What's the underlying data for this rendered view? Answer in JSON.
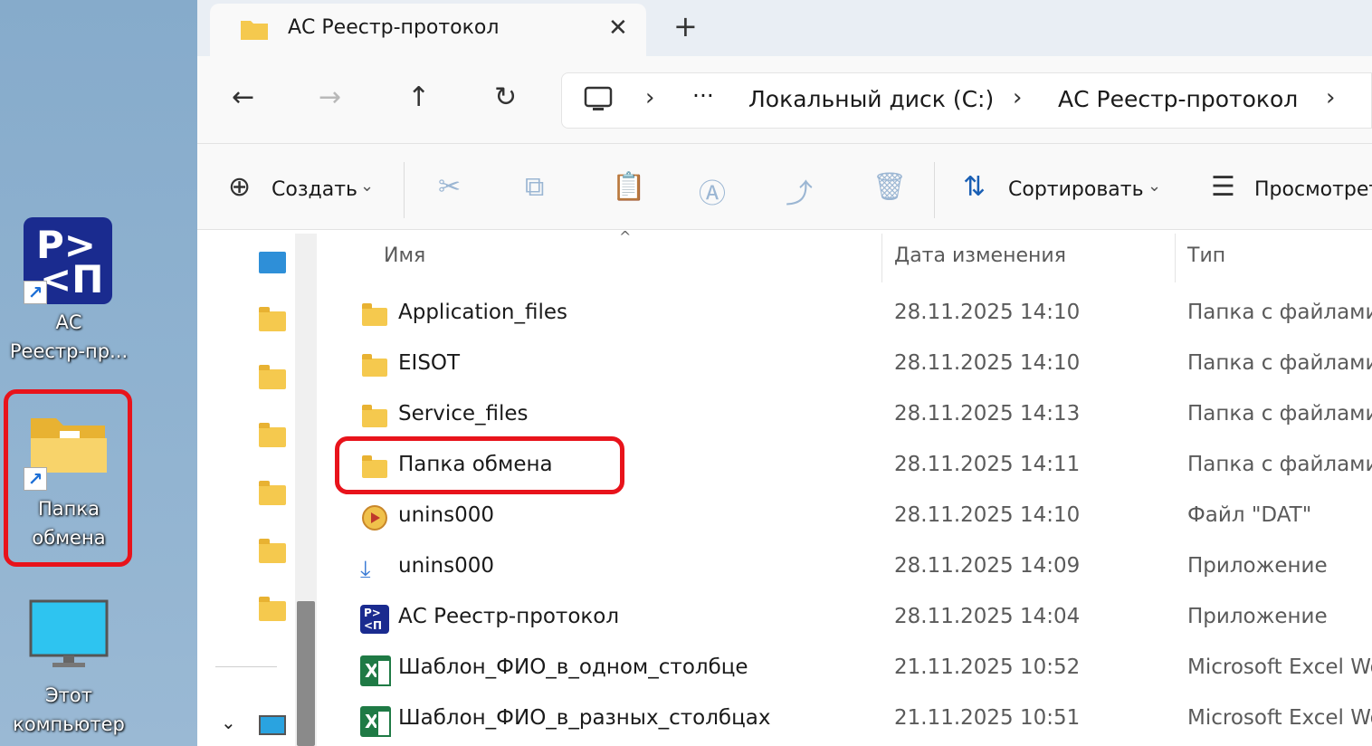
{
  "desktop": {
    "icons": [
      {
        "label": "АС\nРеестр-пр..."
      },
      {
        "label": "Папка\nобмена"
      },
      {
        "label": "Этот\nкомпьютер"
      }
    ],
    "logo_text_top": "P>",
    "logo_text_bottom": "<П",
    "shortcut_glyph": "↗"
  },
  "tab": {
    "title": "АС Реестр-протокол",
    "close": "✕",
    "new": "+"
  },
  "nav": {
    "back": "←",
    "forward": "→",
    "up": "↑",
    "refresh": "↻"
  },
  "address": {
    "more": "···",
    "sep": "›",
    "crumbs": [
      "Локальный диск (C:)",
      "АС Реестр-протокол"
    ]
  },
  "toolbar": {
    "create_icon": "⊕",
    "create": "Создать",
    "dropdown": "⌄",
    "cut_icon": "✂",
    "copy_icon": "⧉",
    "paste_icon": "📋",
    "rename_icon": "Ⓐ",
    "share_icon": "⤴",
    "delete_icon": "🗑",
    "sort_icon": "⇅",
    "sort": "Сортировать",
    "view_icon": "☰",
    "view": "Просмотреть"
  },
  "columns": {
    "name": "Имя",
    "date": "Дата изменения",
    "type": "Тип",
    "sort_indicator": "^"
  },
  "rows": [
    {
      "name": "Application_files",
      "date": "28.11.2025 14:10",
      "type": "Папка с файлами",
      "icon": "folder-icon"
    },
    {
      "name": "EISOT",
      "date": "28.11.2025 14:10",
      "type": "Папка с файлами",
      "icon": "folder-icon"
    },
    {
      "name": "Service_files",
      "date": "28.11.2025 14:13",
      "type": "Папка с файлами",
      "icon": "folder-icon"
    },
    {
      "name": "Папка обмена",
      "date": "28.11.2025 14:11",
      "type": "Папка с файлами",
      "icon": "folder-icon"
    },
    {
      "name": "unins000",
      "date": "28.11.2025 14:10",
      "type": "Файл \"DAT\"",
      "icon": "dat-file-icon"
    },
    {
      "name": "unins000",
      "date": "28.11.2025 14:09",
      "type": "Приложение",
      "icon": "installer-icon"
    },
    {
      "name": "АС Реестр-протокол",
      "date": "28.11.2025 14:04",
      "type": "Приложение",
      "icon": "app-logo-icon"
    },
    {
      "name": "Шаблон_ФИО_в_одном_столбце",
      "date": "21.11.2025 10:52",
      "type": "Microsoft Excel Wo",
      "icon": "excel-icon"
    },
    {
      "name": "Шаблон_ФИО_в_разных_столбцах",
      "date": "21.11.2025 10:51",
      "type": "Microsoft Excel Wo",
      "icon": "excel-icon"
    }
  ],
  "rp_small_text": "P>\n<П",
  "excel_letter": "X",
  "installer_glyph": "⤓",
  "navpane_chevron": "⌄",
  "colors": {
    "highlight": "#e8131b",
    "folder": "#f5c94e",
    "logo": "#1a2b8f"
  }
}
